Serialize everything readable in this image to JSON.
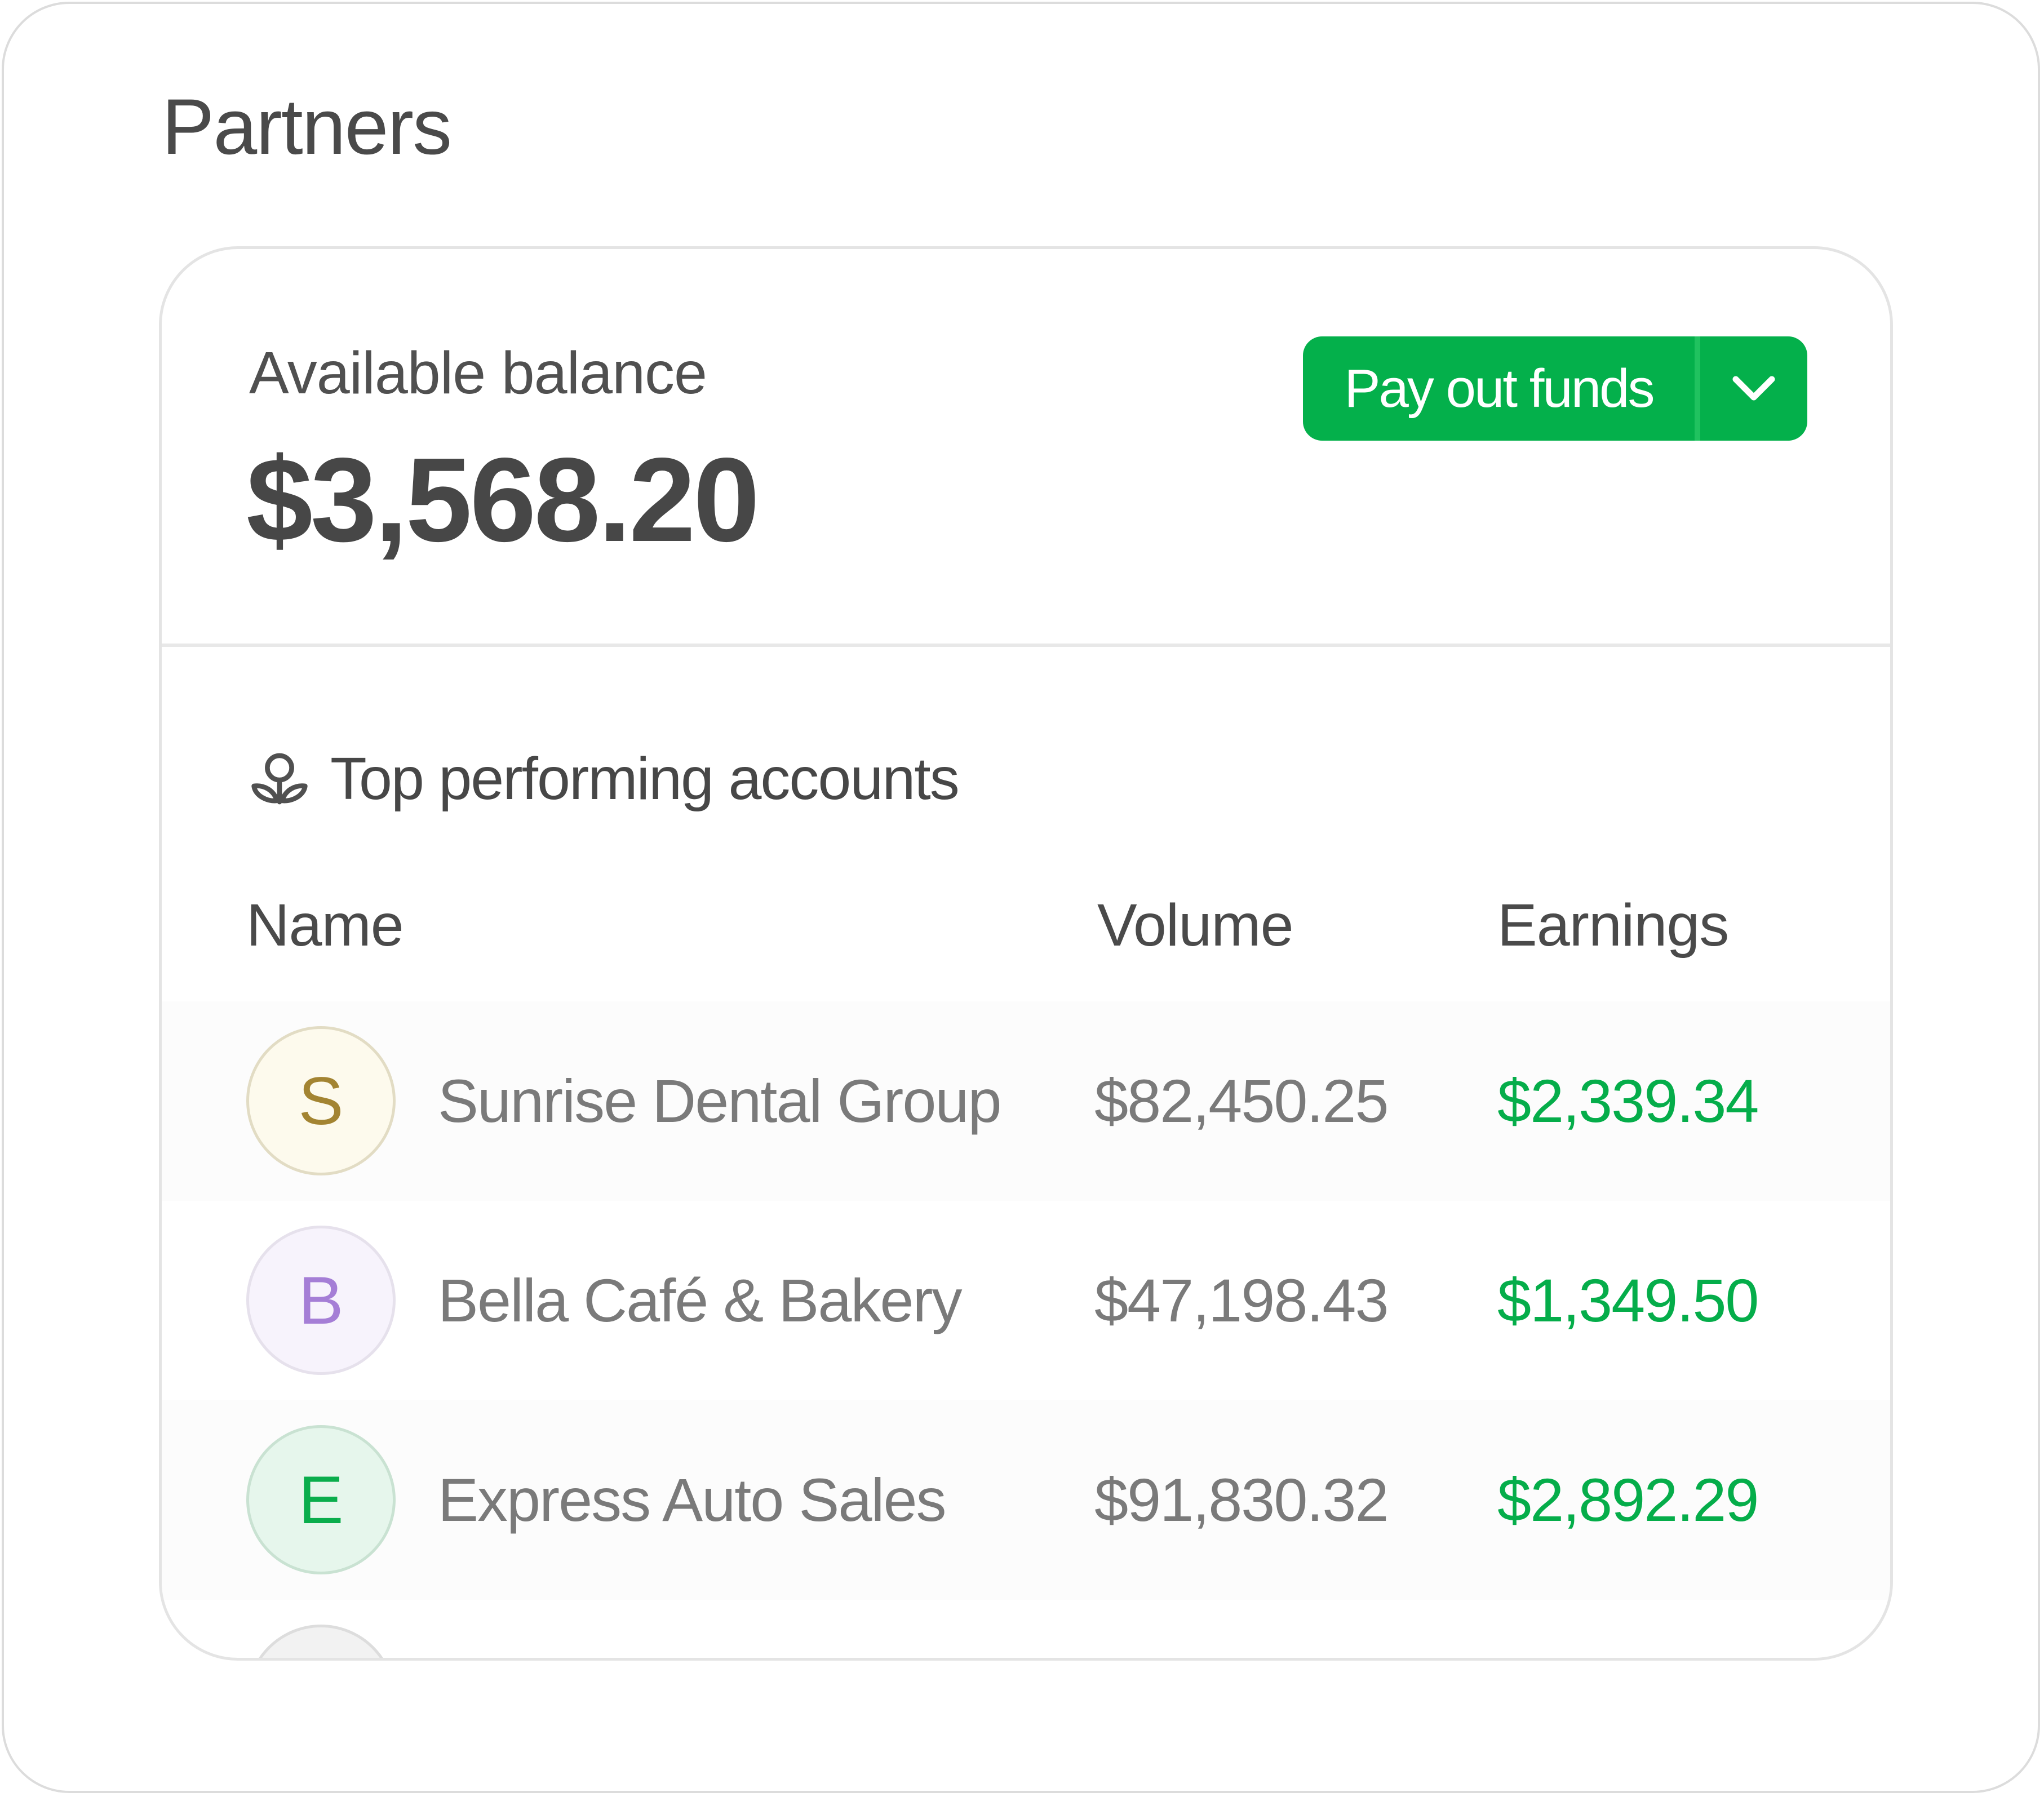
{
  "page": {
    "title": "Partners"
  },
  "balance": {
    "label": "Available balance",
    "amount": "$3,568.20"
  },
  "payout": {
    "label": "Pay out funds",
    "color": "#04b04b"
  },
  "accounts": {
    "title": "Top performing accounts",
    "icon": "partners-icon",
    "columns": {
      "name": "Name",
      "volume": "Volume",
      "earnings": "Earnings"
    },
    "rows": [
      {
        "initial": "S",
        "name": "Sunrise Dental Group",
        "volume": "$82,450.25",
        "earnings": "$2,339.34",
        "avatar_bg": "#fdfaed",
        "avatar_fg": "#a38432",
        "avatar_border": "#e2dcc4"
      },
      {
        "initial": "B",
        "name": "Bella Café & Bakery",
        "volume": "$47,198.43",
        "earnings": "$1,349.50",
        "avatar_bg": "#f7f3fc",
        "avatar_fg": "#a57ed6",
        "avatar_border": "#e6e1ec"
      },
      {
        "initial": "E",
        "name": "Express Auto Sales",
        "volume": "$91,830.32",
        "earnings": "$2,892.29",
        "avatar_bg": "#e6f6ec",
        "avatar_fg": "#0aad4c",
        "avatar_border": "#c9e2d2"
      },
      {
        "initial": "",
        "name": "",
        "volume": "",
        "earnings": "",
        "avatar_bg": "#f2f2f2",
        "avatar_fg": "#999999",
        "avatar_border": "#dddddd"
      }
    ]
  }
}
